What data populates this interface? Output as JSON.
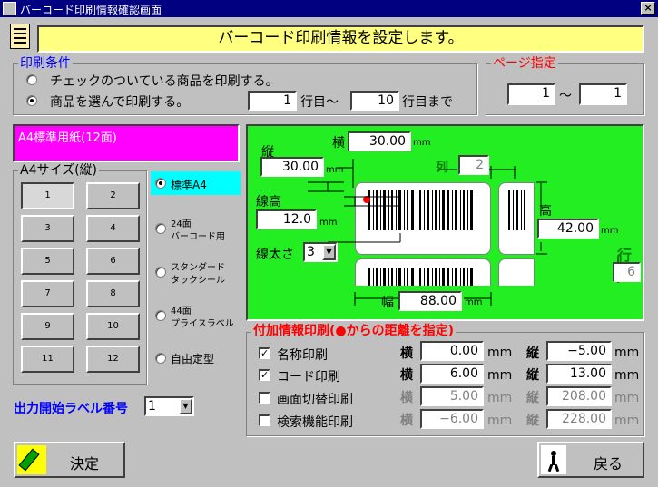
{
  "window": {
    "title": "バーコード印刷情報確認画面",
    "close": "×"
  },
  "banner": {
    "message": "バーコード印刷情報を設定します。"
  },
  "conditions": {
    "title": "印刷条件",
    "option_checked": "チェックのついている商品を印刷する。",
    "option_selected": "商品を選んで印刷する。",
    "from_row": "1",
    "from_suffix": "行目～",
    "to_row": "10",
    "to_suffix": "行目まで"
  },
  "page": {
    "title": "ページ指定",
    "from": "1",
    "sep": "～",
    "to": "1"
  },
  "paper": {
    "name": "A4標準用紙(12面)"
  },
  "size_group": {
    "title": "A4サイズ(縦)",
    "cells": [
      "1",
      "2",
      "3",
      "4",
      "5",
      "6",
      "7",
      "8",
      "9",
      "10",
      "11",
      "12"
    ]
  },
  "paper_types": {
    "standard": "標準A4",
    "t24a": "24面",
    "t24b": "バーコード用",
    "stda": "スタンダード",
    "stdb": "タックシール",
    "t44a": "44面",
    "t44b": "プライスラベル",
    "custom": "自由定型"
  },
  "layout": {
    "yoko_label": "横",
    "yoko": "30.00",
    "tate_label": "縦",
    "tate": "30.00",
    "col_label": "列",
    "col": "2",
    "senko_label": "線高",
    "senko": "12.0",
    "height_label": "高",
    "height": "42.00",
    "line_width_label": "線太さ",
    "line_width": "3",
    "row_label": "行",
    "row": "6",
    "width_label": "幅",
    "width": "88.00",
    "mm": "mm"
  },
  "extra": {
    "title": "付加情報印刷(●からの距離を指定)",
    "x_label": "横",
    "y_label": "縦",
    "mm": "mm",
    "rows": [
      {
        "label": "名称印刷",
        "x": "0.00",
        "y": "−5.00",
        "checked": "✓"
      },
      {
        "label": "コード印刷",
        "x": "6.00",
        "y": "13.00",
        "checked": "✓"
      },
      {
        "label": "画面切替印刷",
        "x": "5.00",
        "y": "208.00",
        "checked": ""
      },
      {
        "label": "検索機能印刷",
        "x": "−6.00",
        "y": "228.00",
        "checked": ""
      }
    ]
  },
  "start_label": {
    "label": "出力開始ラベル番号",
    "value": "1"
  },
  "buttons": {
    "ok": "決定",
    "back": "戻る"
  },
  "colors": {
    "green": "#22ee22",
    "magenta": "#ff00ff",
    "cyan": "#00ffff",
    "banner": "#ffff80",
    "red": "#ff0000"
  }
}
